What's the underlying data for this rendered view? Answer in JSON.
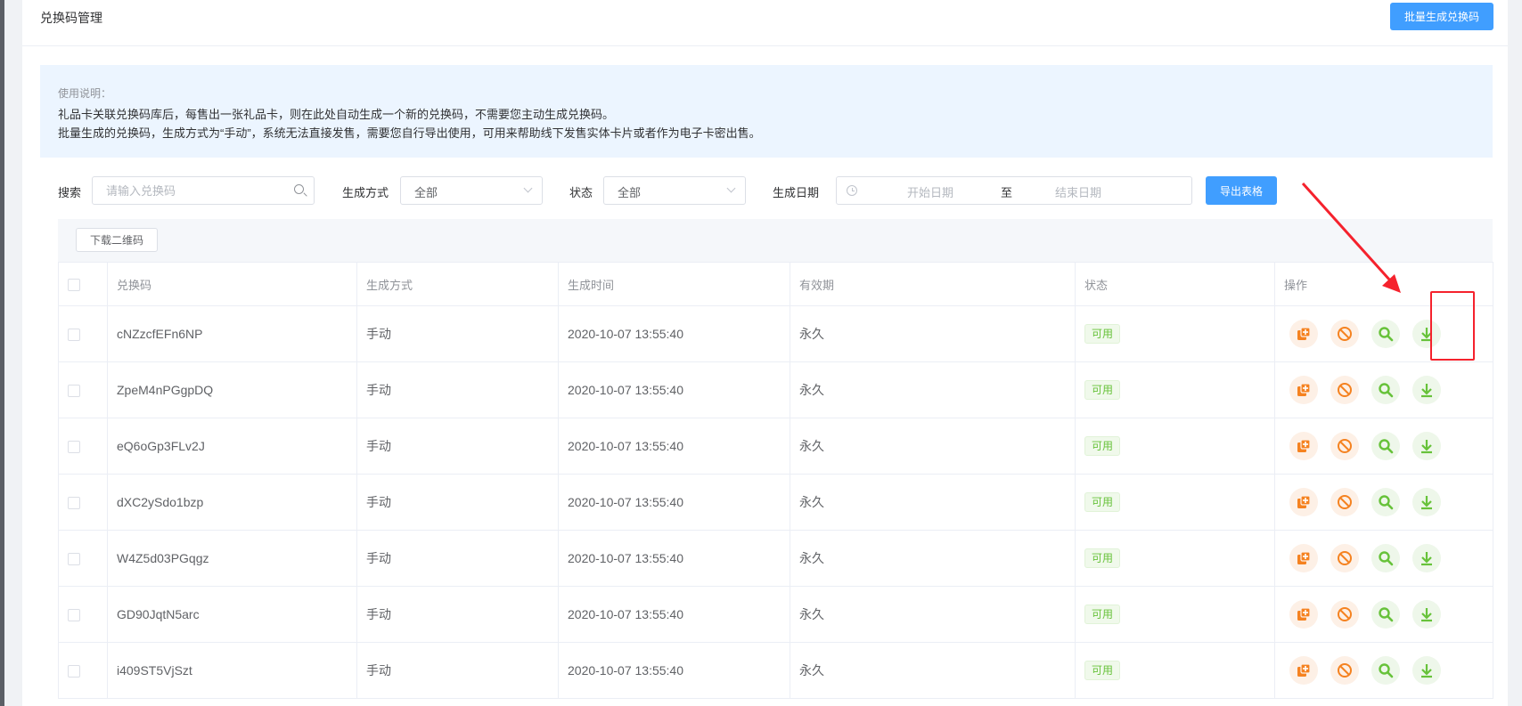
{
  "page": {
    "title": "兑换码管理",
    "batch_button": "批量生成兑换码"
  },
  "notice": {
    "title": "使用说明：",
    "lines": [
      "礼品卡关联兑换码库后，每售出一张礼品卡，则在此处自动生成一个新的兑换码，不需要您主动生成兑换码。",
      "批量生成的兑换码，生成方式为“手动”，系统无法直接发售，需要您自行导出使用，可用来帮助线下发售实体卡片或者作为电子卡密出售。"
    ]
  },
  "filters": {
    "search_label": "搜索",
    "search_placeholder": "请输入兑换码",
    "method_label": "生成方式",
    "method_value": "全部",
    "status_label": "状态",
    "status_value": "全部",
    "date_label": "生成日期",
    "date_start_placeholder": "开始日期",
    "date_separator": "至",
    "date_end_placeholder": "结束日期",
    "export_button": "导出表格"
  },
  "toolbar": {
    "download_qr_button": "下载二维码"
  },
  "table": {
    "columns": [
      "兑换码",
      "生成方式",
      "生成时间",
      "有效期",
      "状态",
      "操作"
    ],
    "rows": [
      {
        "code": "cNZzcfEFn6NP",
        "method": "手动",
        "time": "2020-10-07 13:55:40",
        "validity": "永久",
        "status": "可用"
      },
      {
        "code": "ZpeM4nPGgpDQ",
        "method": "手动",
        "time": "2020-10-07 13:55:40",
        "validity": "永久",
        "status": "可用"
      },
      {
        "code": "eQ6oGp3FLv2J",
        "method": "手动",
        "time": "2020-10-07 13:55:40",
        "validity": "永久",
        "status": "可用"
      },
      {
        "code": "dXC2ySdo1bzp",
        "method": "手动",
        "time": "2020-10-07 13:55:40",
        "validity": "永久",
        "status": "可用"
      },
      {
        "code": "W4Z5d03PGqgz",
        "method": "手动",
        "time": "2020-10-07 13:55:40",
        "validity": "永久",
        "status": "可用"
      },
      {
        "code": "GD90JqtN5arc",
        "method": "手动",
        "time": "2020-10-07 13:55:40",
        "validity": "永久",
        "status": "可用"
      },
      {
        "code": "i409ST5VjSzt",
        "method": "手动",
        "time": "2020-10-07 13:55:40",
        "validity": "永久",
        "status": "可用"
      }
    ]
  },
  "icons": {
    "copy": "copy-icon",
    "disable": "disable-icon",
    "view": "search-icon",
    "download": "download-icon"
  },
  "colors": {
    "primary": "#409eff",
    "orange": "#f58220",
    "green": "#67c23a",
    "annotation_red": "#f5222d"
  }
}
